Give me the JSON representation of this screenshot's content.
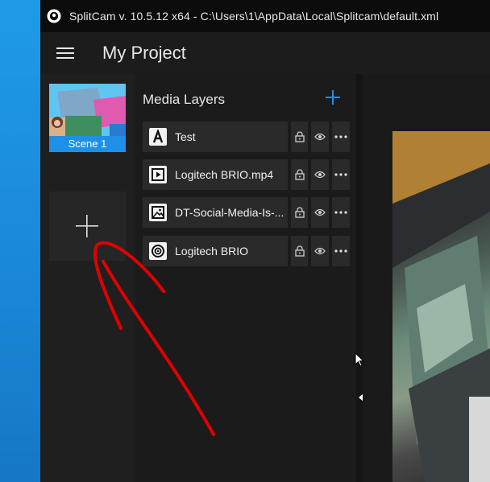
{
  "window": {
    "title": "SplitCam v. 10.5.12 x64 - C:\\Users\\1\\AppData\\Local\\Splitcam\\default.xml"
  },
  "appbar": {
    "project_title": "My Project"
  },
  "scenes": {
    "items": [
      {
        "label": "Scene 1",
        "selected": true
      }
    ]
  },
  "layers": {
    "header": "Media Layers",
    "items": [
      {
        "name": "Test",
        "icon": "text-layer-icon"
      },
      {
        "name": "Logitech BRIO.mp4",
        "icon": "video-file-icon"
      },
      {
        "name": "DT-Social-Media-Is-...",
        "icon": "image-file-icon"
      },
      {
        "name": "Logitech BRIO",
        "icon": "webcam-icon"
      }
    ]
  },
  "colors": {
    "accent": "#1e90e8",
    "annotation": "#e00000"
  }
}
